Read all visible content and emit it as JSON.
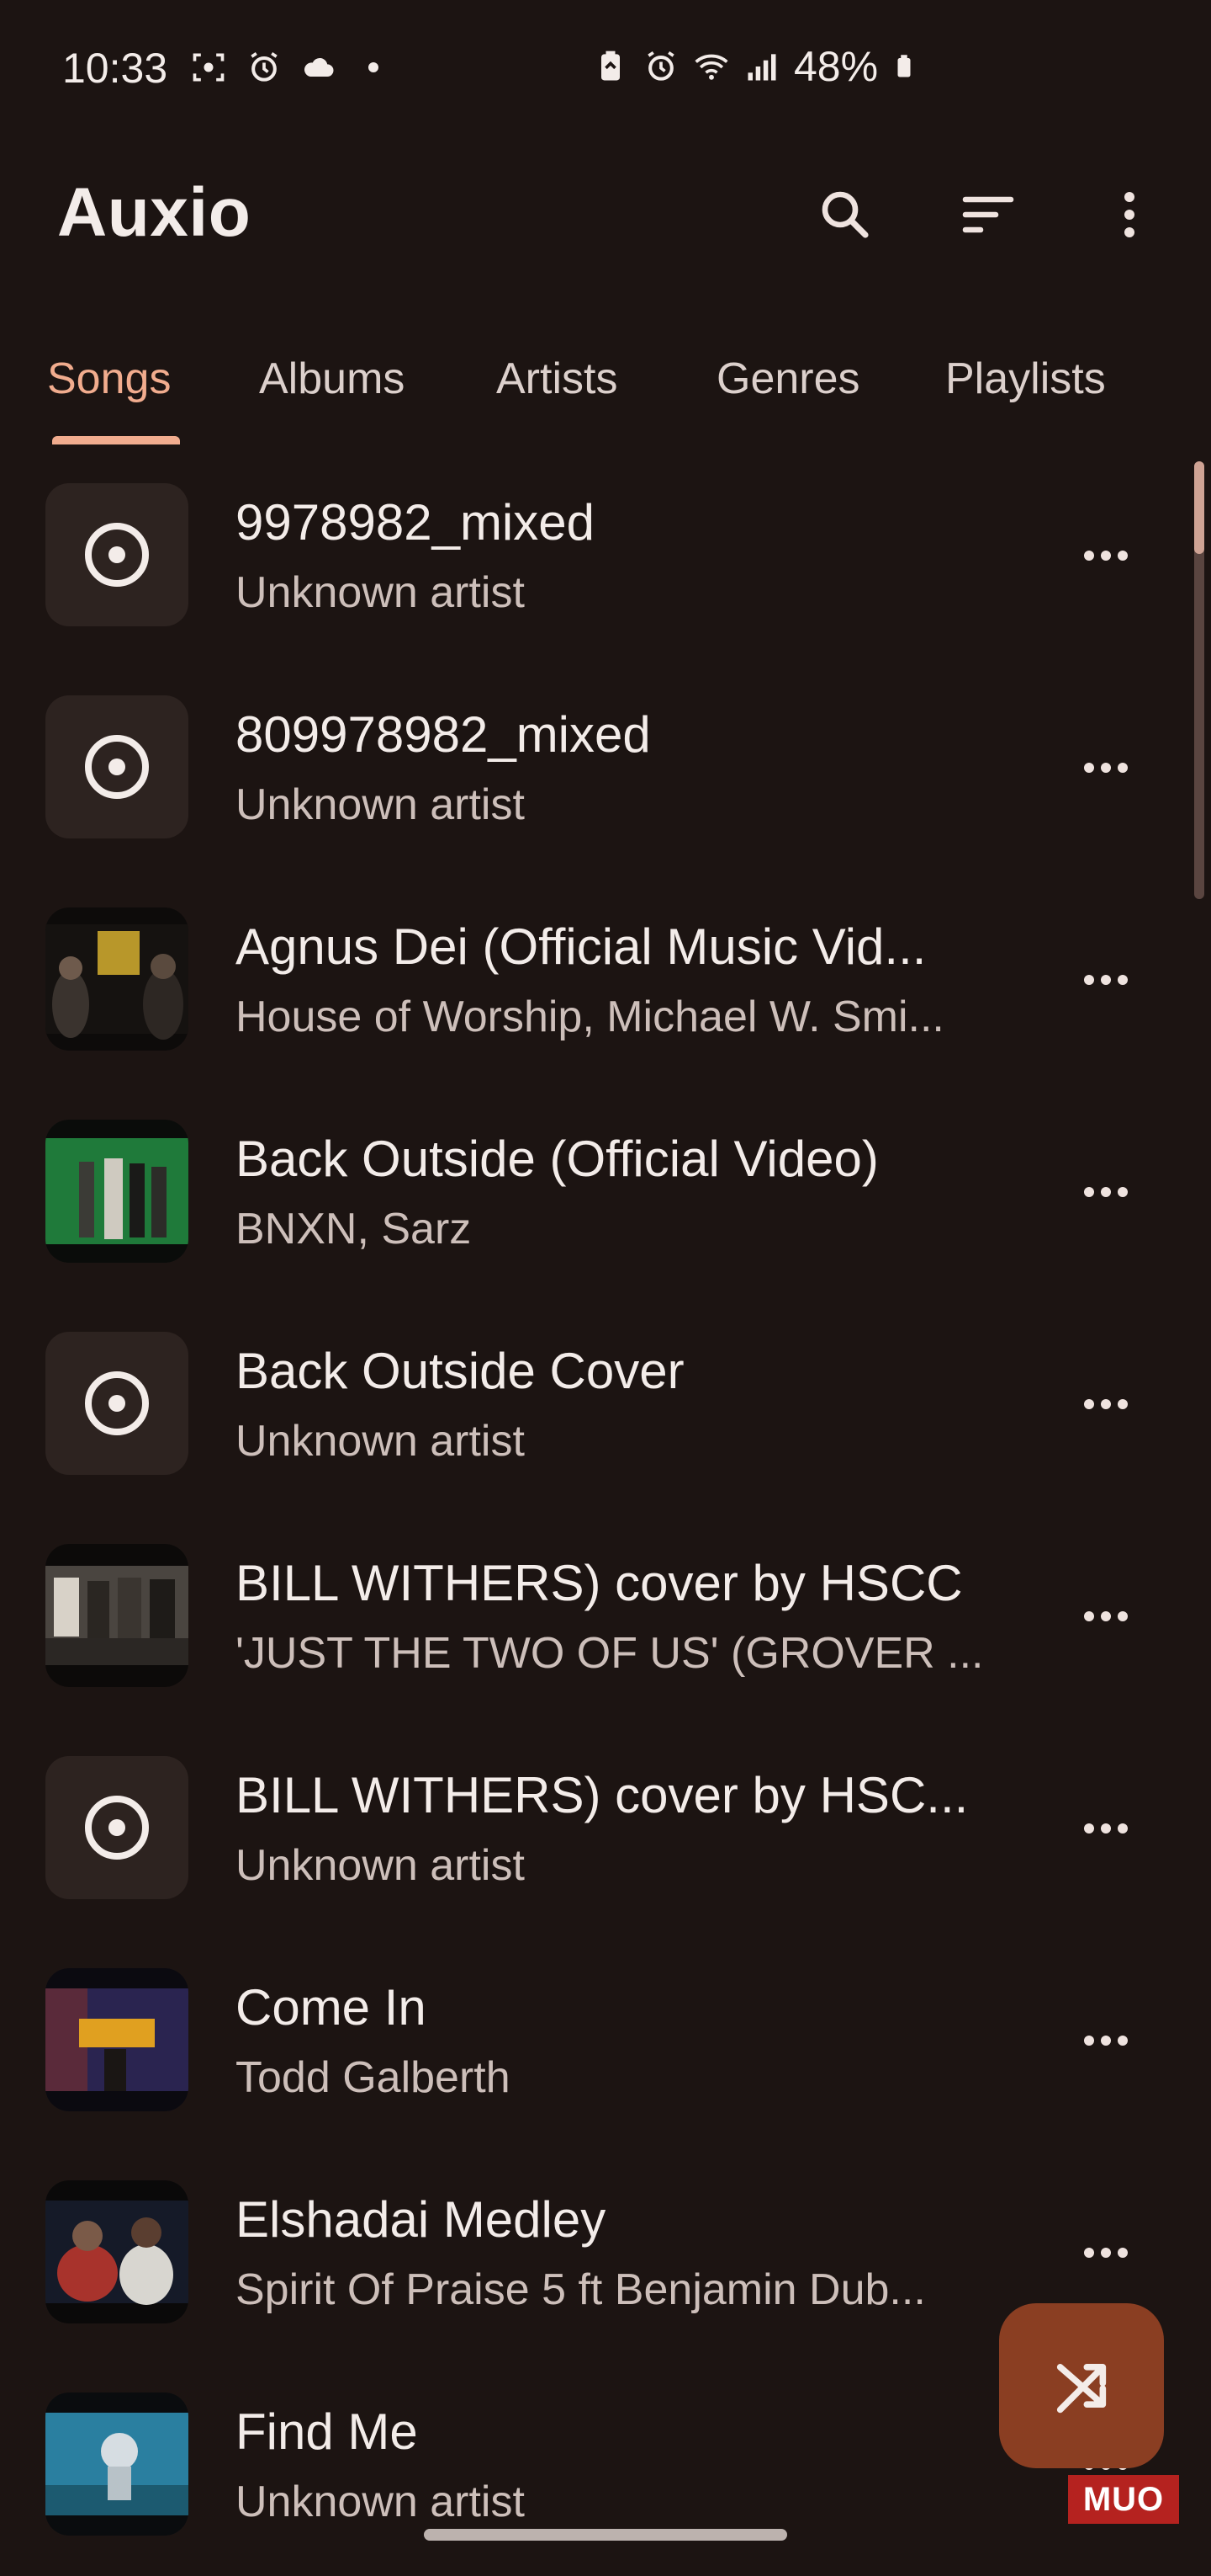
{
  "status_bar": {
    "time": "10:33",
    "battery_percent": "48%"
  },
  "app": {
    "title": "Auxio"
  },
  "tabs": [
    {
      "label": "Songs",
      "active": true
    },
    {
      "label": "Albums",
      "active": false
    },
    {
      "label": "Artists",
      "active": false
    },
    {
      "label": "Genres",
      "active": false
    },
    {
      "label": "Playlists",
      "active": false
    }
  ],
  "songs": [
    {
      "title": "9978982_mixed",
      "artist": "Unknown artist",
      "art": "default-disc-icon"
    },
    {
      "title": "809978982_mixed",
      "artist": "Unknown artist",
      "art": "default-disc-icon"
    },
    {
      "title": "Agnus Dei (Official Music Vid...",
      "artist": "House of Worship, Michael W. Smi...",
      "art": "video-thumbnail"
    },
    {
      "title": "Back Outside (Official Video)",
      "artist": "BNXN, Sarz",
      "art": "video-thumbnail"
    },
    {
      "title": "Back Outside Cover",
      "artist": "Unknown artist",
      "art": "default-disc-icon"
    },
    {
      "title": "BILL WITHERS) cover by HSCC",
      "artist": "'JUST THE TWO OF US' (GROVER ...",
      "art": "video-thumbnail"
    },
    {
      "title": "BILL WITHERS) cover by HSC...",
      "artist": "Unknown artist",
      "art": "default-disc-icon"
    },
    {
      "title": "Come In",
      "artist": "Todd Galberth",
      "art": "video-thumbnail"
    },
    {
      "title": "Elshadai Medley",
      "artist": "Spirit Of Praise 5 ft Benjamin Dub...",
      "art": "video-thumbnail"
    },
    {
      "title": "Find Me",
      "artist": "Unknown artist",
      "art": "video-thumbnail"
    }
  ],
  "watermark": "MUO",
  "colors": {
    "background": "#1c1412",
    "accent": "#f1ac8e",
    "fab": "#8a3e22",
    "text_primary": "#f3ece9",
    "text_secondary": "#cdbfba"
  }
}
